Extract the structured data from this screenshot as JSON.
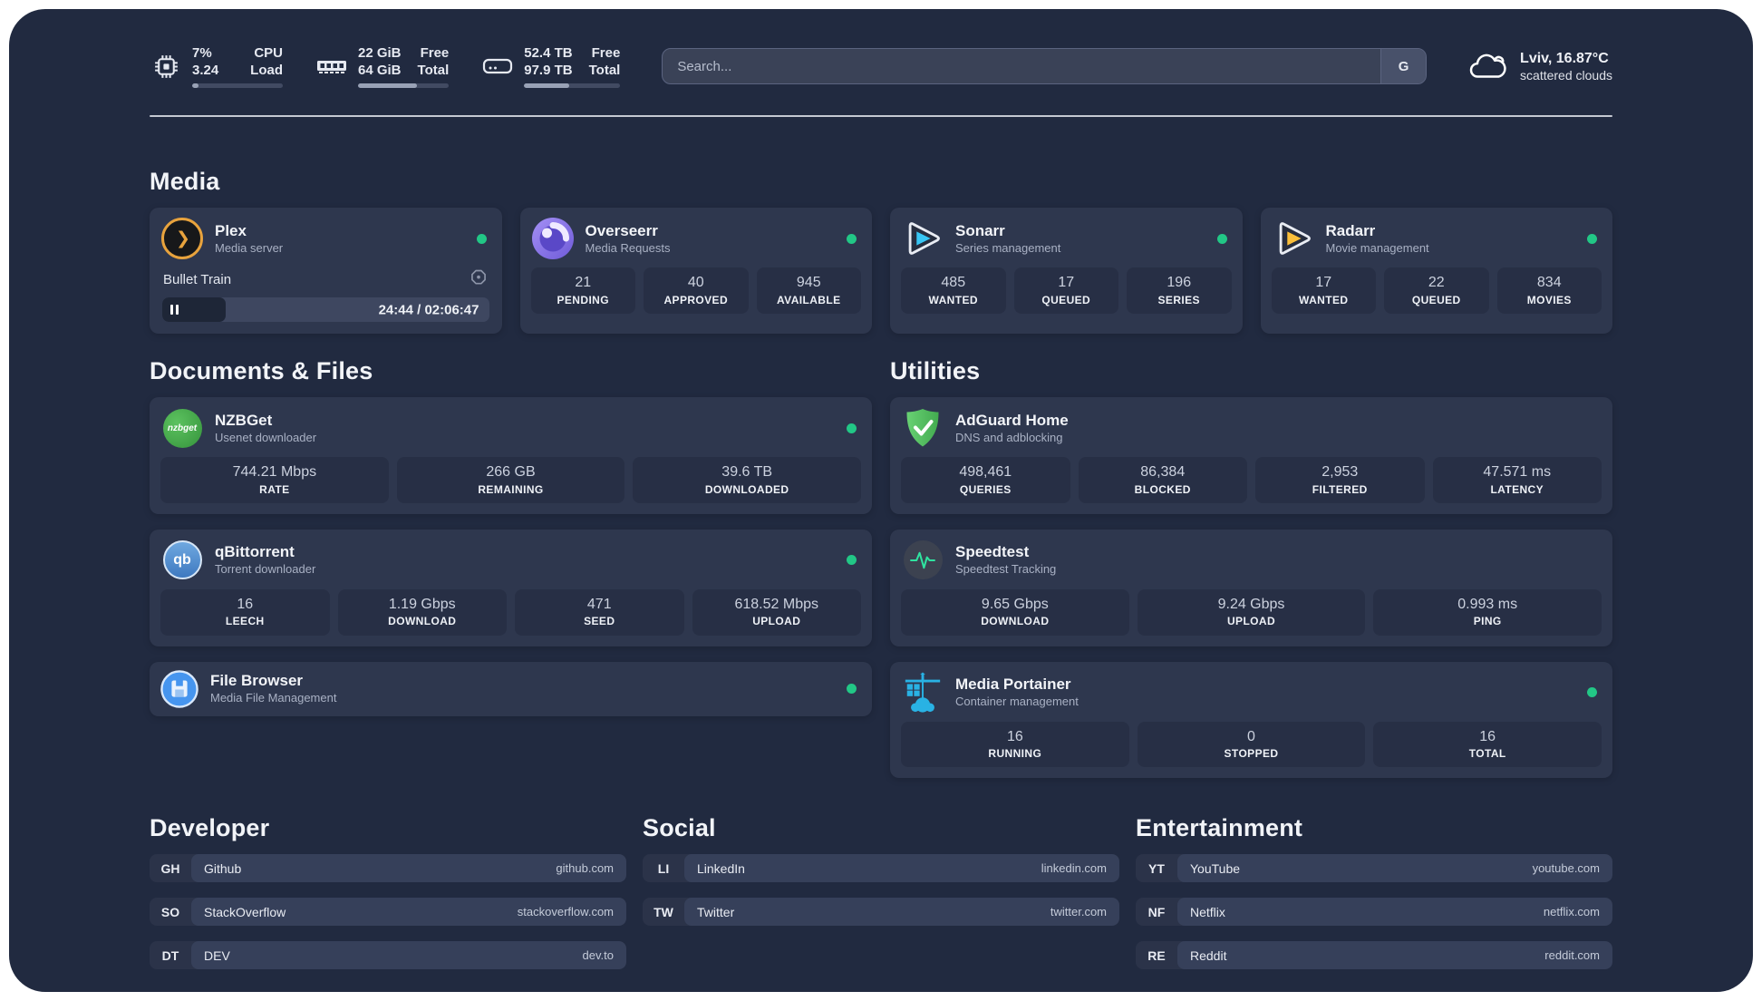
{
  "topbar": {
    "stats": [
      {
        "icon": "cpu",
        "values": [
          "7%",
          "3.24"
        ],
        "labels": [
          "CPU",
          "Load"
        ],
        "progress_pct": 7
      },
      {
        "icon": "memory",
        "values": [
          "22 GiB",
          "64 GiB"
        ],
        "labels": [
          "Free",
          "Total"
        ],
        "progress_pct": 65
      },
      {
        "icon": "disk",
        "values": [
          "52.4 TB",
          "97.9 TB"
        ],
        "labels": [
          "Free",
          "Total"
        ],
        "progress_pct": 47
      }
    ],
    "search": {
      "placeholder": "Search...",
      "button_label": "G"
    },
    "weather": {
      "location": "Lviv, 16.87°C",
      "condition": "scattered clouds"
    }
  },
  "sections": {
    "media": {
      "title": "Media",
      "apps": [
        {
          "name": "Plex",
          "subtitle": "Media server",
          "icon": "plex",
          "online": true,
          "player": {
            "track": "Bullet Train",
            "elapsed": "24:44",
            "duration": "02:06:47",
            "progress_pct": 19.5,
            "state": "paused"
          }
        },
        {
          "name": "Overseerr",
          "subtitle": "Media Requests",
          "icon": "overseerr",
          "online": true,
          "stats": [
            {
              "value": "21",
              "label": "PENDING"
            },
            {
              "value": "40",
              "label": "APPROVED"
            },
            {
              "value": "945",
              "label": "AVAILABLE"
            }
          ]
        },
        {
          "name": "Sonarr",
          "subtitle": "Series management",
          "icon": "sonarr",
          "online": true,
          "stats": [
            {
              "value": "485",
              "label": "WANTED"
            },
            {
              "value": "17",
              "label": "QUEUED"
            },
            {
              "value": "196",
              "label": "SERIES"
            }
          ]
        },
        {
          "name": "Radarr",
          "subtitle": "Movie management",
          "icon": "radarr",
          "online": true,
          "stats": [
            {
              "value": "17",
              "label": "WANTED"
            },
            {
              "value": "22",
              "label": "QUEUED"
            },
            {
              "value": "834",
              "label": "MOVIES"
            }
          ]
        }
      ]
    },
    "documents": {
      "title": "Documents & Files",
      "apps": [
        {
          "name": "NZBGet",
          "subtitle": "Usenet downloader",
          "icon": "nzbget",
          "online": true,
          "stats": [
            {
              "value": "744.21 Mbps",
              "label": "RATE"
            },
            {
              "value": "266 GB",
              "label": "REMAINING"
            },
            {
              "value": "39.6 TB",
              "label": "DOWNLOADED"
            }
          ]
        },
        {
          "name": "qBittorrent",
          "subtitle": "Torrent downloader",
          "icon": "qbittorrent",
          "online": true,
          "stats": [
            {
              "value": "16",
              "label": "LEECH"
            },
            {
              "value": "1.19 Gbps",
              "label": "DOWNLOAD"
            },
            {
              "value": "471",
              "label": "SEED"
            },
            {
              "value": "618.52 Mbps",
              "label": "UPLOAD"
            }
          ]
        },
        {
          "name": "File Browser",
          "subtitle": "Media File Management",
          "icon": "filebrowser",
          "online": true,
          "compact": true
        }
      ]
    },
    "utilities": {
      "title": "Utilities",
      "apps": [
        {
          "name": "AdGuard Home",
          "subtitle": "DNS and adblocking",
          "icon": "adguard",
          "online": false,
          "stats": [
            {
              "value": "498,461",
              "label": "QUERIES"
            },
            {
              "value": "86,384",
              "label": "BLOCKED"
            },
            {
              "value": "2,953",
              "label": "FILTERED"
            },
            {
              "value": "47.571 ms",
              "label": "LATENCY"
            }
          ]
        },
        {
          "name": "Speedtest",
          "subtitle": "Speedtest Tracking",
          "icon": "speedtest",
          "online": false,
          "stats": [
            {
              "value": "9.65 Gbps",
              "label": "DOWNLOAD"
            },
            {
              "value": "9.24 Gbps",
              "label": "UPLOAD"
            },
            {
              "value": "0.993 ms",
              "label": "PING"
            }
          ]
        },
        {
          "name": "Media Portainer",
          "subtitle": "Container management",
          "icon": "portainer",
          "online": true,
          "stats": [
            {
              "value": "16",
              "label": "RUNNING"
            },
            {
              "value": "0",
              "label": "STOPPED"
            },
            {
              "value": "16",
              "label": "TOTAL"
            }
          ]
        }
      ]
    },
    "links": [
      {
        "title": "Developer",
        "items": [
          {
            "tag": "GH",
            "name": "Github",
            "url": "github.com"
          },
          {
            "tag": "SO",
            "name": "StackOverflow",
            "url": "stackoverflow.com"
          },
          {
            "tag": "DT",
            "name": "DEV",
            "url": "dev.to"
          }
        ]
      },
      {
        "title": "Social",
        "items": [
          {
            "tag": "LI",
            "name": "LinkedIn",
            "url": "linkedin.com"
          },
          {
            "tag": "TW",
            "name": "Twitter",
            "url": "twitter.com"
          }
        ]
      },
      {
        "title": "Entertainment",
        "items": [
          {
            "tag": "YT",
            "name": "YouTube",
            "url": "youtube.com"
          },
          {
            "tag": "NF",
            "name": "Netflix",
            "url": "netflix.com"
          },
          {
            "tag": "RE",
            "name": "Reddit",
            "url": "reddit.com"
          }
        ]
      }
    ]
  },
  "colors": {
    "background": "#212a40",
    "card": "#2e374e",
    "stat_box": "#272f45",
    "status_online": "#22c786",
    "plex_accent": "#e8a33d",
    "sonarr_accent": "#38c6f4",
    "radarr_accent": "#fbbf3a",
    "speedtest_accent": "#2fe3a0",
    "portainer_accent": "#29b2e4"
  }
}
